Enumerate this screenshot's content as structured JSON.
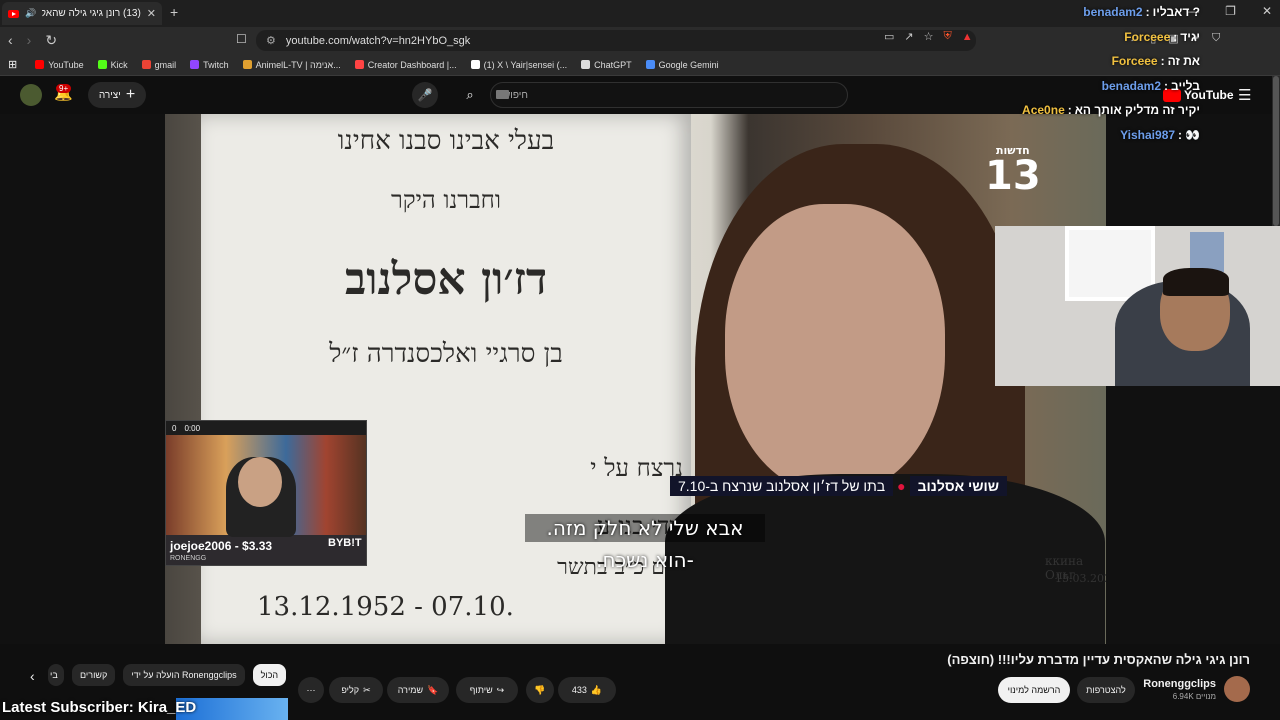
{
  "browser": {
    "tab_title": "(13) רונן גיגי גילה שהאקסית ע",
    "url": "youtube.com/watch?v=hn2HYbO_sgk",
    "bookmarks": [
      {
        "label": "YouTube",
        "color": "#ff0000"
      },
      {
        "label": "Kick",
        "color": "#53fc18"
      },
      {
        "label": "gmail",
        "color": "#ea4335"
      },
      {
        "label": "Twitch",
        "color": "#9146ff"
      },
      {
        "label": "AnimelL-TV | אנימה...",
        "color": "#e0a030"
      },
      {
        "label": "Creator Dashboard |...",
        "color": "#ff4444"
      },
      {
        "label": "(1) X \\ Yair|sensei (...",
        "color": "#ffffff"
      },
      {
        "label": "ChatGPT",
        "color": "#dddddd"
      },
      {
        "label": "Google Gemini",
        "color": "#4a8cf7"
      }
    ]
  },
  "youtube": {
    "notification_count": "9+",
    "create_label": "יצירה",
    "search_placeholder": "חיפוש",
    "logo_text": "YouTube"
  },
  "video": {
    "stone_lines": [
      "בעלי אבינו סבנו אחינו",
      "וחברנו היקר",
      "דז׳ון אסלנוב",
      "בן סרגיי ואלכסנדרה ז״ל",
      "נרצח על י",
      "בידי בני ע",
      "ביום כ״ב בתשר",
      "13.12.1952 - 07.10."
    ],
    "logo_top": "חדשות",
    "logo_num": "13",
    "lower_name": "שושי אסלנוב",
    "lower_desc": "בתו של דז׳ון אסלנוב שנרצח ב-7.10",
    "subtitle_1": "אבא שלי לא חלק מזה.",
    "subtitle_2": "-הוא נשכח.",
    "side_text": "ккина Ольг",
    "side_date": "15.03.202"
  },
  "webcam1": {
    "score_1": "0",
    "score_2": "0:00",
    "donation": "joejoe2006 - $3.33",
    "brand": "RONENGG",
    "sponsor": "BYB!T"
  },
  "chat": [
    {
      "user": "benadam2",
      "msg": "? דאבליו",
      "color": "blue"
    },
    {
      "user": "Forceee",
      "msg": "יגיד",
      "color": "orange"
    },
    {
      "user": "Forceee",
      "msg": "את זה",
      "color": "orange"
    },
    {
      "user": "benadam2",
      "msg": "בלייב",
      "color": "blue"
    },
    {
      "user": "Ace0ne",
      "msg": "יקיר זה מדליק אותך הא",
      "color": "orange"
    },
    {
      "user": "Yishai987",
      "msg": "👀",
      "color": "blue"
    }
  ],
  "below": {
    "title": "רונן גיגי גילה שהאקסית עדיין מדברת עליו!!! (חוצפה)",
    "channel": "Ronenggclips",
    "subs": "6.94K מנויים",
    "subscribe": "הרשמה למינוי",
    "join": "להצטרפות",
    "likes": "433",
    "share": "שיתוף",
    "save": "שמירה",
    "clip": "קליפ",
    "chips": [
      "הכול",
      "הועלה על ידי Ronenggclips",
      "קשורים",
      "בי"
    ],
    "latest": "Latest Subscriber: Kira_ED"
  },
  "colors": {
    "accent": "#ff0000",
    "chat_blue": "#6d9eeb",
    "chat_orange": "#f0c040",
    "lowerthird": "#12142a"
  }
}
